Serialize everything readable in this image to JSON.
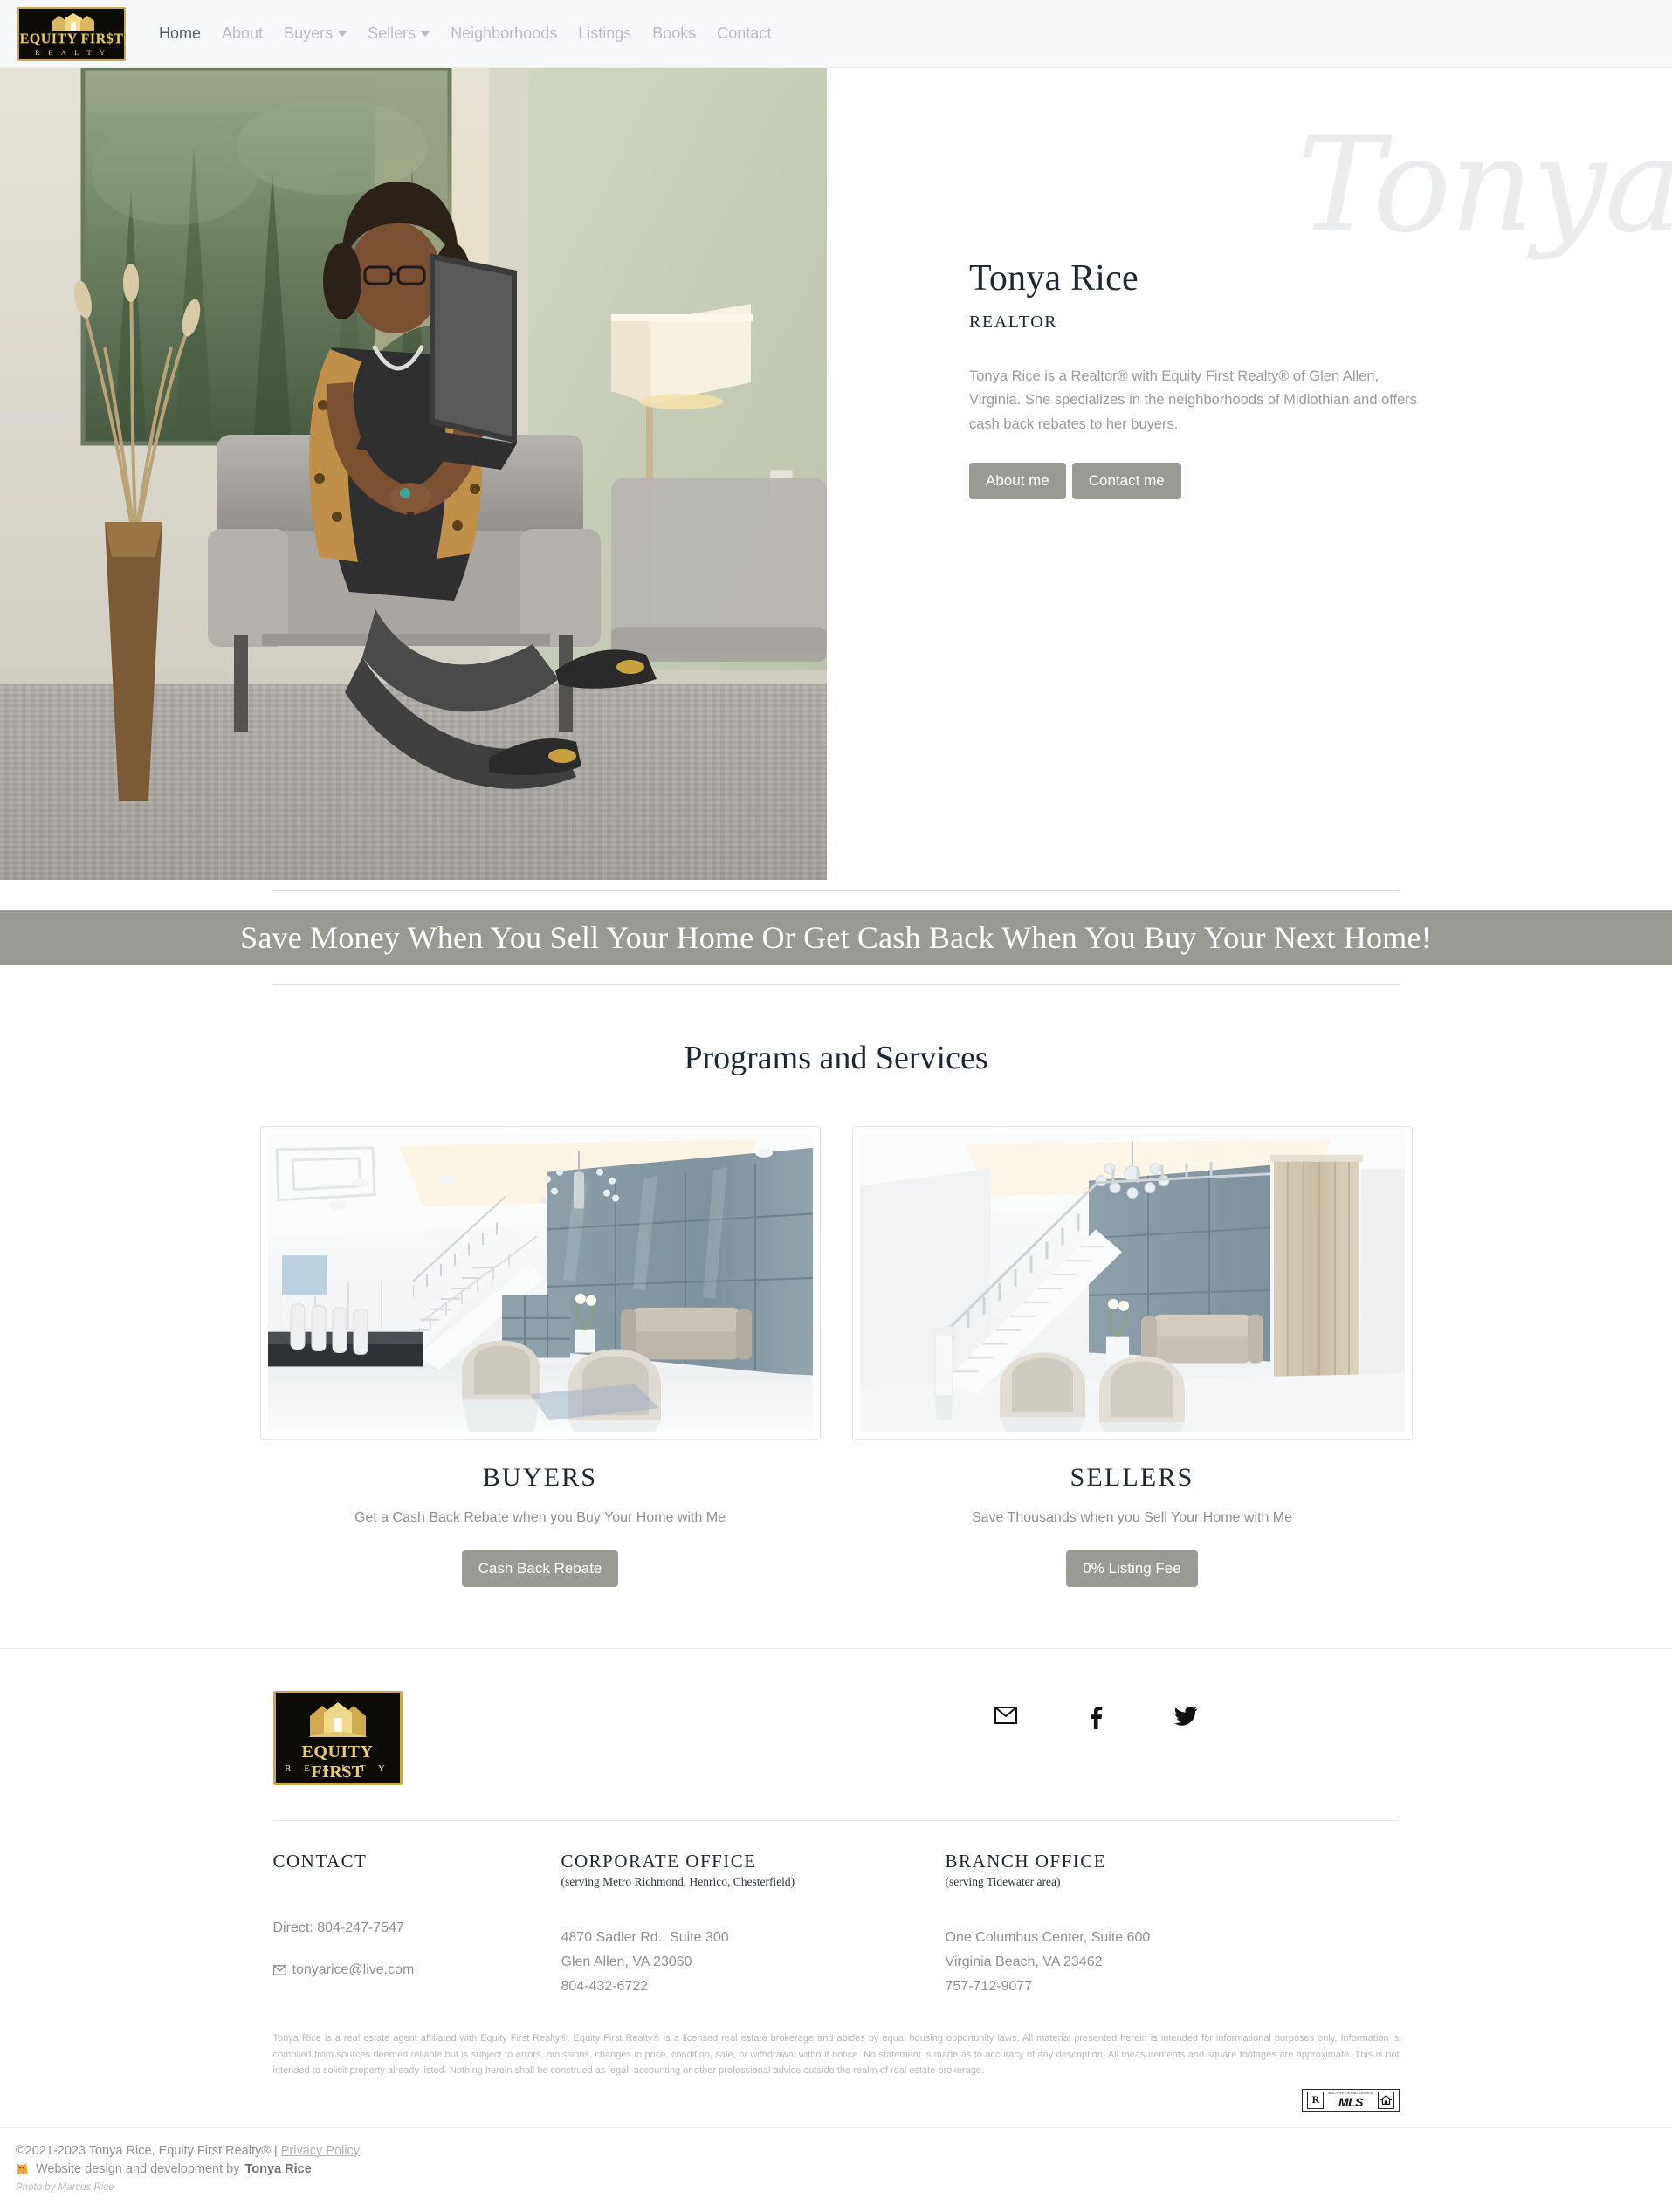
{
  "brand": {
    "logo_line1": "EQUITY FIR$T",
    "logo_line2": "FIR$T",
    "logo_line3": "R E A L T Y",
    "logo_name": "equity-first-realty-logo",
    "gold": "#c9a84c",
    "black": "#0d0b06"
  },
  "nav": {
    "items": [
      {
        "label": "Home",
        "active": true,
        "caret": false
      },
      {
        "label": "About",
        "active": false,
        "caret": false
      },
      {
        "label": "Buyers",
        "active": false,
        "caret": true
      },
      {
        "label": "Sellers",
        "active": false,
        "caret": true
      },
      {
        "label": "Neighborhoods",
        "active": false,
        "caret": false
      },
      {
        "label": "Listings",
        "active": false,
        "caret": false
      },
      {
        "label": "Books",
        "active": false,
        "caret": false
      },
      {
        "label": "Contact",
        "active": false,
        "caret": false
      }
    ]
  },
  "hero": {
    "watermark": "Tonya",
    "name": "Tonya Rice",
    "role": "REALTOR",
    "bio": "Tonya Rice is a Realtor® with Equity First Realty® of Glen Allen, Virginia. She specializes in the neighborhoods of Midlothian and offers cash back rebates to her buyers.",
    "button_about": "About me",
    "button_contact": "Contact me",
    "photo_alt": "Tonya Rice seated in armchair holding laptop",
    "accent_button": "#9a9a92"
  },
  "banner": {
    "text": "Save Money When You Sell Your Home Or Get Cash Back When You Buy Your Next Home!",
    "background": "#9a9a92"
  },
  "programs": {
    "title": "Programs and Services",
    "cards": [
      {
        "title": "BUYERS",
        "subtitle": "Get a Cash Back Rebate when you Buy Your Home with Me",
        "button": "Cash Back Rebate",
        "image_alt": "Modern white interior with staircase and blue paneled wall"
      },
      {
        "title": "SELLERS",
        "subtitle": "Save Thousands when you Sell Your Home with Me",
        "button": "0% Listing Fee",
        "image_alt": "Bright staircase foyer with seating area"
      }
    ]
  },
  "footer": {
    "social": [
      {
        "name": "email-icon",
        "label": "Email"
      },
      {
        "name": "facebook-icon",
        "label": "Facebook"
      },
      {
        "name": "twitter-icon",
        "label": "Twitter"
      }
    ],
    "columns": {
      "contact": {
        "head": "CONTACT",
        "sub": "",
        "direct": "Direct: 804-247-7547",
        "email": "tonyarice@live.com"
      },
      "corporate": {
        "head": "CORPORATE OFFICE",
        "sub": "(serving Metro Richmond, Henrico, Chesterfield)",
        "line1": "4870 Sadler Rd., Suite 300",
        "line2": "Glen Allen, VA 23060",
        "line3": "804-432-6722"
      },
      "branch": {
        "head": "BRANCH OFFICE",
        "sub": "(serving Tidewater area)",
        "line1": "One Columbus Center, Suite 600",
        "line2": "Virginia Beach, VA 23462",
        "line3": "757-712-9077"
      }
    },
    "disclaimer": "Tonya Rice is a real estate agent affiliated with Equity First Realty®. Equity First Realty® is a licensed real estate brokerage and abides by equal housing opportunity laws. All material presented herein is intended for informational purposes only. Information is compiled from sources deemed reliable but is subject to errors, omissions, changes in price, condition, sale, or withdrawal without notice. No statement is made as to accuracy of any description. All measurements and square footages are approximate. This is not intended to solicit property already listed. Nothing herein shall be construed as legal, accounting or other professional advice outside the realm of real estate brokerage.",
    "badges": {
      "realtor": "R",
      "mls": "MLS",
      "mls_caption": "MULTIPLE LISTING SERVICE",
      "eho": "Equal Housing Opportunity"
    },
    "copyright": "©2021-2023 Tonya Rice, Equity First Realty® | ",
    "privacy_policy": "Privacy Policy",
    "credit_prefix": "Website design and development by ",
    "credit_name": "Tonya Rice",
    "credit_icon": "cat-icon",
    "photo_credit": "Photo by Marcus Rice"
  }
}
